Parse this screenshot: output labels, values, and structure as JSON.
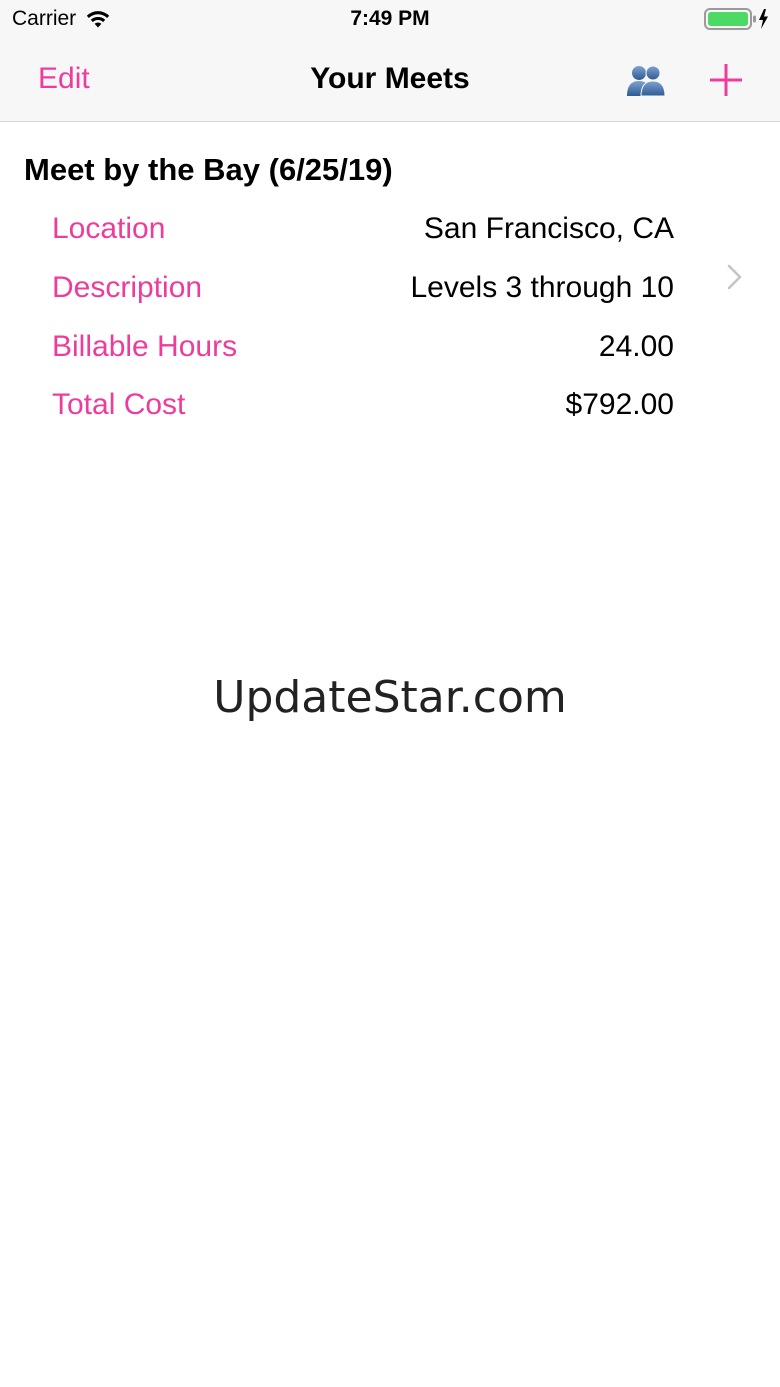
{
  "status_bar": {
    "carrier": "Carrier",
    "time": "7:49 PM",
    "icons": [
      "wifi-icon",
      "battery-icon",
      "charging-bolt-icon"
    ]
  },
  "nav_bar": {
    "edit_label": "Edit",
    "title": "Your Meets",
    "icons": [
      "people-icon",
      "add-icon"
    ],
    "accent_color": "#ec3c9c"
  },
  "meet": {
    "title": "Meet by the Bay (6/25/19)",
    "rows": [
      {
        "label": "Location",
        "value": "San Francisco, CA"
      },
      {
        "label": "Description",
        "value": "Levels 3 through 10"
      },
      {
        "label": "Billable Hours",
        "value": "24.00"
      },
      {
        "label": "Total Cost",
        "value": "$792.00"
      }
    ],
    "disclosure_icon": "chevron-right-icon"
  },
  "watermark": "UpdateStar.com"
}
